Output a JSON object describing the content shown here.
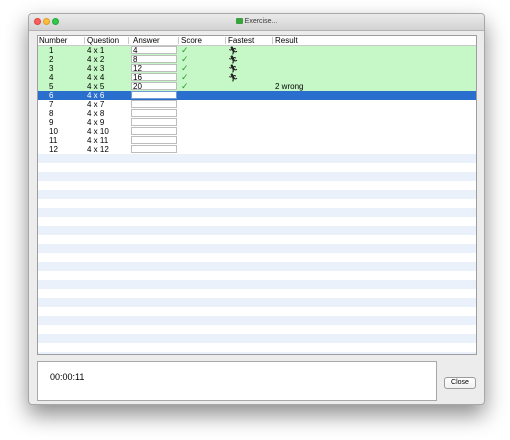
{
  "window": {
    "title": "Exercise..."
  },
  "table": {
    "columns": [
      "Number",
      "Question",
      "Answer",
      "Score",
      "Fastest",
      "Result"
    ],
    "rows": [
      {
        "number": "1",
        "question": "4 x 1",
        "answer": "4",
        "score": "check-icon",
        "fastest": "runner-icon",
        "result": "",
        "state": "done"
      },
      {
        "number": "2",
        "question": "4 x 2",
        "answer": "8",
        "score": "check-icon",
        "fastest": "runner-icon",
        "result": "",
        "state": "done"
      },
      {
        "number": "3",
        "question": "4 x 3",
        "answer": "12",
        "score": "check-icon",
        "fastest": "runner-icon",
        "result": "",
        "state": "done"
      },
      {
        "number": "4",
        "question": "4 x 4",
        "answer": "16",
        "score": "check-icon",
        "fastest": "runner-icon",
        "result": "",
        "state": "done"
      },
      {
        "number": "5",
        "question": "4 x 5",
        "answer": "20",
        "score": "check-icon",
        "fastest": "",
        "result": "2 wrong",
        "state": "done"
      },
      {
        "number": "6",
        "question": "4 x 6",
        "answer": "",
        "score": "",
        "fastest": "",
        "result": "",
        "state": "selected"
      },
      {
        "number": "7",
        "question": "4 x 7",
        "answer": "",
        "score": "",
        "fastest": "",
        "result": "",
        "state": "pending"
      },
      {
        "number": "8",
        "question": "4 x 8",
        "answer": "",
        "score": "",
        "fastest": "",
        "result": "",
        "state": "pending"
      },
      {
        "number": "9",
        "question": "4 x 9",
        "answer": "",
        "score": "",
        "fastest": "",
        "result": "",
        "state": "pending"
      },
      {
        "number": "10",
        "question": "4 x 10",
        "answer": "",
        "score": "",
        "fastest": "",
        "result": "",
        "state": "pending"
      },
      {
        "number": "11",
        "question": "4 x 11",
        "answer": "",
        "score": "",
        "fastest": "",
        "result": "",
        "state": "pending"
      },
      {
        "number": "12",
        "question": "4 x 12",
        "answer": "",
        "score": "",
        "fastest": "",
        "result": "",
        "state": "pending"
      }
    ]
  },
  "timer": {
    "value": "00:00:11"
  },
  "buttons": {
    "close_label": "Close"
  },
  "colors": {
    "done_row": "#c6f7c6",
    "selected_row": "#2a6fcd",
    "stripe_row": "#ebf1fb",
    "check": "#2f9a2f"
  }
}
